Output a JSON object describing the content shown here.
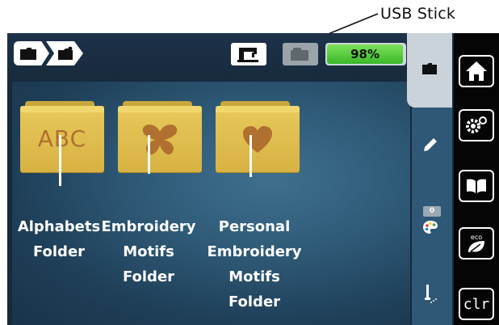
{
  "annotations": {
    "usb_stick": "USB Stick",
    "alphabets_folder": [
      "Alphabets",
      "Folder"
    ],
    "embroidery_motifs_folder": [
      "Embroidery",
      "Motifs",
      "Folder"
    ],
    "personal_embroidery_motifs_folder": [
      "Personal",
      "Embroidery",
      "Motifs",
      "Folder"
    ]
  },
  "status": {
    "battery_percent": "98%",
    "battery_level": 0.98
  },
  "folders": {
    "alphabets": {
      "label": "ABC"
    }
  },
  "right_panel": {
    "color_count": "0"
  },
  "sidebar": {
    "clr_label": "clr"
  },
  "colors": {
    "screen_bg": "#17293a",
    "content_bg": "#2f5b78",
    "folder": "#e0bf4e",
    "folder_symbol": "#b0702f",
    "battery": "#39b829",
    "sidebar": "#050505"
  },
  "icons": {
    "breadcrumb": [
      "folder-icon",
      "folder-open-icon"
    ],
    "status": [
      "sewing-machine-icon",
      "usb-stick-icon"
    ],
    "right_panel": [
      "folder-icon",
      "pencil-icon",
      "color-palette-icon",
      "needle-icon"
    ],
    "sidebar": [
      "home-icon",
      "settings-icon",
      "book-icon",
      "eco-icon",
      "clear-button"
    ]
  }
}
